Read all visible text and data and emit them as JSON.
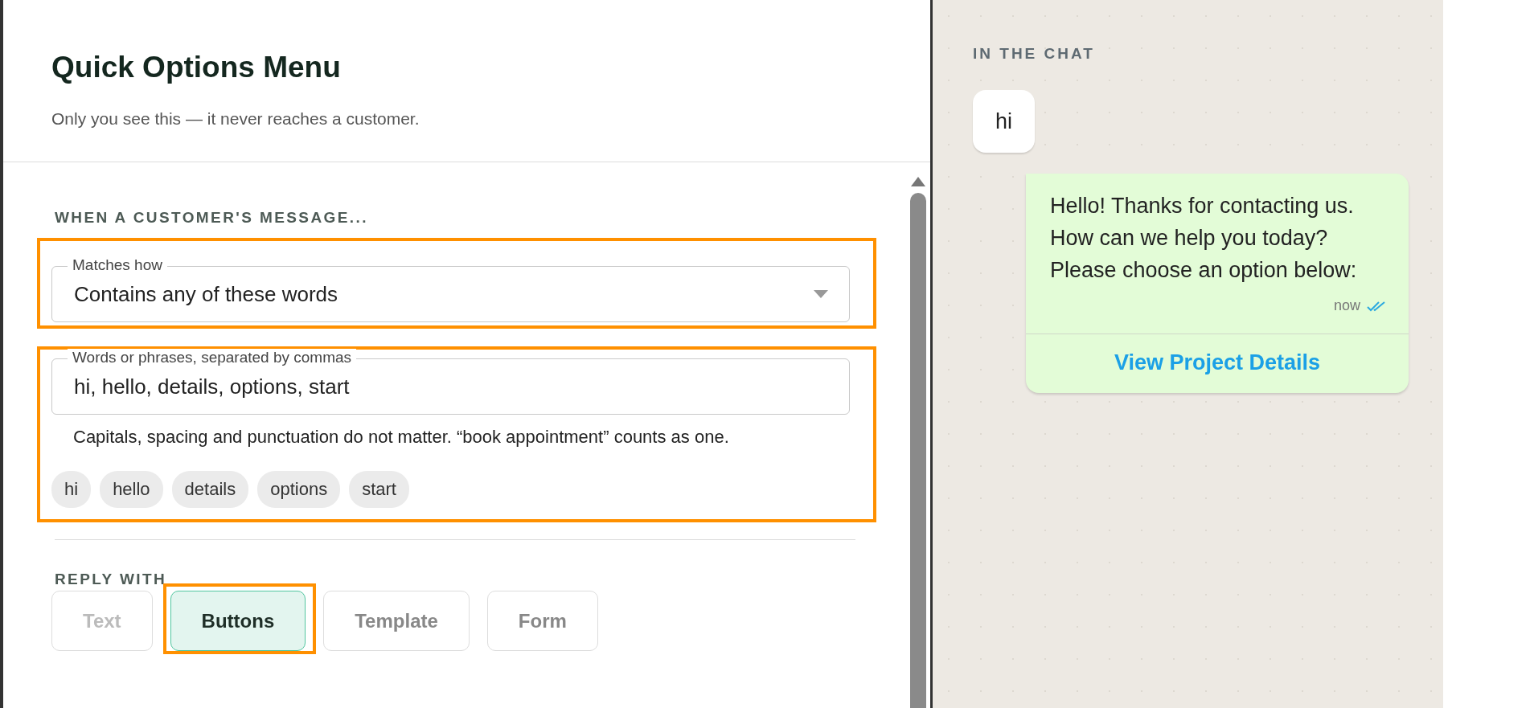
{
  "dialog": {
    "title": "Quick Options Menu",
    "subtitle": "Only you see this — it never reaches a customer."
  },
  "trigger": {
    "heading": "WHEN A CUSTOMER'S MESSAGE...",
    "match_field": {
      "label": "Matches how",
      "value": "Contains any of these words",
      "highlighted": true
    },
    "words_field": {
      "label": "Words or phrases, separated by commas",
      "value": "hi, hello, details, options, start",
      "highlighted": true,
      "help": "Capitals, spacing and punctuation do not matter. “book appointment” counts as one.",
      "chips": [
        "hi",
        "hello",
        "details",
        "options",
        "start"
      ]
    }
  },
  "reply": {
    "heading": "REPLY WITH",
    "types": [
      {
        "label": "Text",
        "selected": false,
        "disabled": true,
        "highlighted": false
      },
      {
        "label": "Buttons",
        "selected": true,
        "disabled": false,
        "highlighted": true
      },
      {
        "label": "Template",
        "selected": false,
        "disabled": false,
        "highlighted": false
      },
      {
        "label": "Form",
        "selected": false,
        "disabled": false,
        "highlighted": false
      }
    ]
  },
  "chat": {
    "heading": "IN THE CHAT",
    "messages": [
      {
        "kind": "incoming",
        "text": "hi"
      },
      {
        "kind": "outgoing",
        "text": "Hello! Thanks for contacting us. How can we help you today? Please choose an option below:",
        "time": "now",
        "buttons": [
          "View Project Details"
        ]
      }
    ]
  }
}
